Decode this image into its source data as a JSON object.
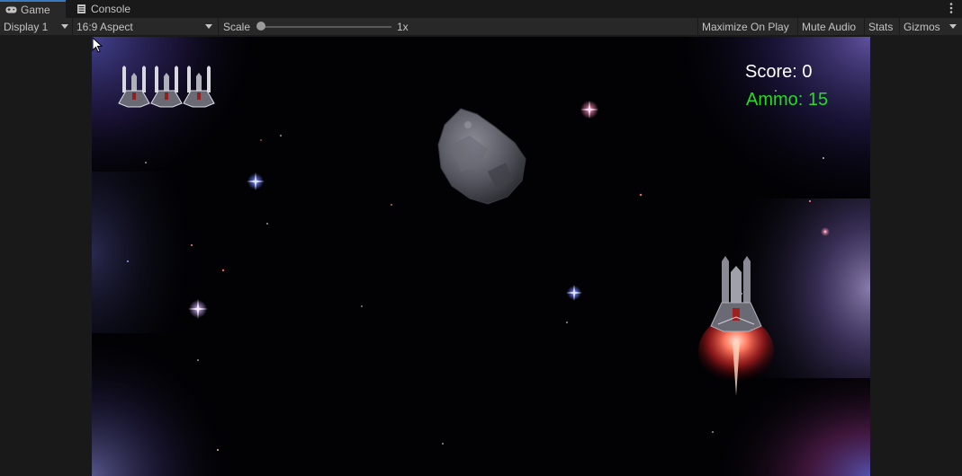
{
  "tabs": [
    {
      "label": "Game",
      "icon": "gamepad-icon"
    },
    {
      "label": "Console",
      "icon": "console-icon"
    }
  ],
  "toolbar": {
    "display": "Display 1",
    "aspect": "16:9 Aspect",
    "scale_label": "Scale",
    "scale_value": "1x",
    "maximize": "Maximize On Play",
    "mute": "Mute Audio",
    "stats": "Stats",
    "gizmos": "Gizmos"
  },
  "game": {
    "score": "Score: 0",
    "ammo": "Ammo: 15",
    "lives": 3
  },
  "colors": {
    "editor_bg": "#191919",
    "toolbar_bg": "#282828",
    "tab_accent": "#3a79bb",
    "score_text": "#ffffff",
    "ammo_text": "#22dd22"
  }
}
